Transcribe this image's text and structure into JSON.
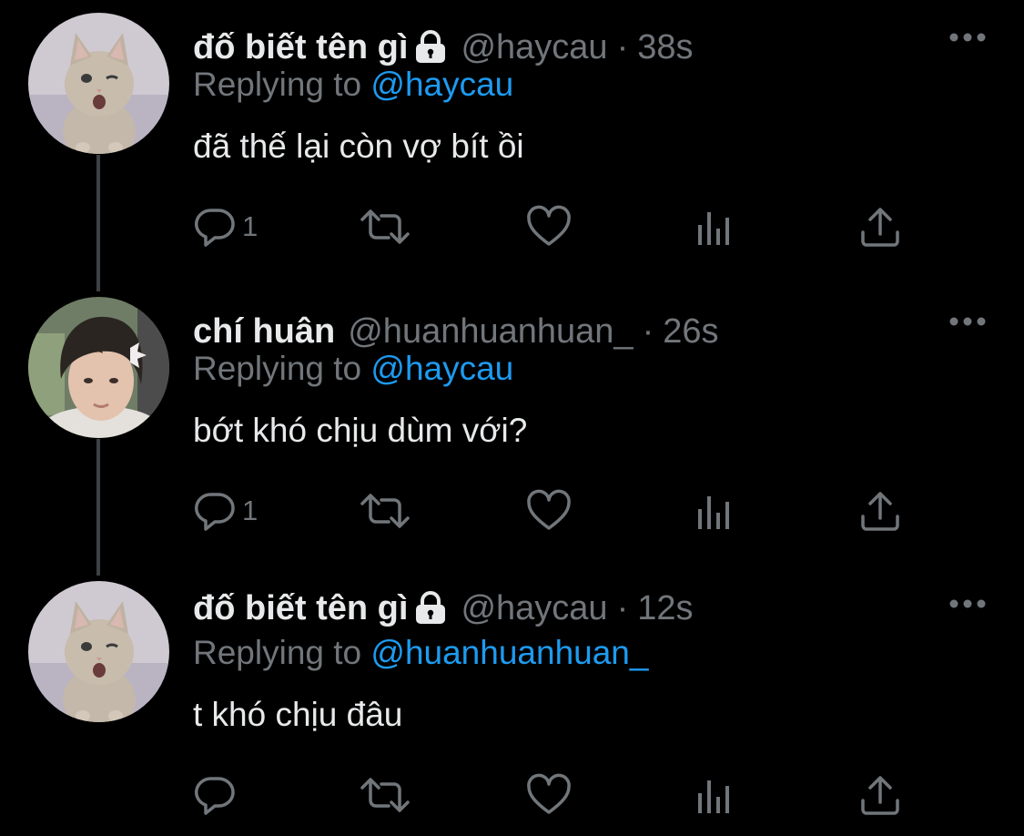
{
  "colors": {
    "background": "#000000",
    "primary_text": "#e7e9ea",
    "secondary_text": "#71767b",
    "mention": "#1d9bf0",
    "thread_line": "#3e4144"
  },
  "tweets": [
    {
      "display_name": "đố biết tên gì",
      "protected": true,
      "handle": "@haycau",
      "separator": "·",
      "time": "38s",
      "replying_prefix": "Replying to",
      "replying_to": "@haycau",
      "text": "đã thế lại còn vợ bít ồi",
      "reply_count": "1",
      "avatar": "kitten-avatar"
    },
    {
      "display_name": "chí huân",
      "protected": false,
      "handle": "@huanhuanhuan_",
      "separator": "·",
      "time": "26s",
      "replying_prefix": "Replying to",
      "replying_to": "@haycau",
      "text": "bớt khó chịu dùm với?",
      "reply_count": "1",
      "avatar": "person-avatar"
    },
    {
      "display_name": "đố biết tên gì",
      "protected": true,
      "handle": "@haycau",
      "separator": "·",
      "time": "12s",
      "replying_prefix": "Replying to",
      "replying_to": "@huanhuanhuan_",
      "text": "t khó chịu đâu",
      "reply_count": "",
      "avatar": "kitten-avatar"
    }
  ],
  "icons": {
    "more": "more-horizontal-icon",
    "lock": "lock-icon",
    "reply": "reply-icon",
    "retweet": "retweet-icon",
    "like": "heart-icon",
    "analytics": "analytics-icon",
    "share": "share-icon"
  }
}
